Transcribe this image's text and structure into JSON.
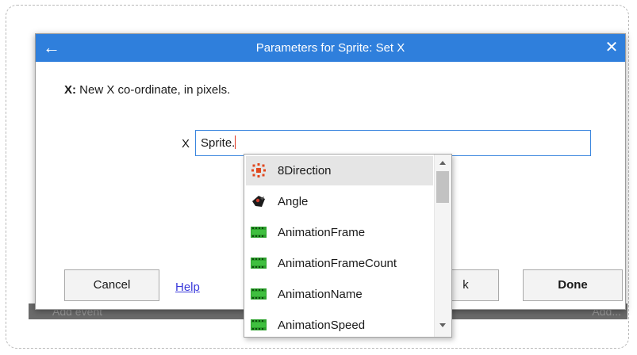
{
  "background_bar": {
    "add_event_label": "Add event",
    "add_right_label": "Add..."
  },
  "dialog": {
    "title": "Parameters for Sprite: Set X",
    "back_icon": "arrow-left-icon",
    "close_icon": "close-icon",
    "description_name": "X:",
    "description_text": " New X co-ordinate, in pixels.",
    "param_label": "X",
    "param_value": "Sprite.",
    "buttons": {
      "cancel": "Cancel",
      "help": "Help",
      "hidden_partial": "k",
      "done": "Done"
    }
  },
  "autocomplete": {
    "items": [
      {
        "label": "8Direction",
        "icon": "8direction-behavior-icon",
        "selected": true
      },
      {
        "label": "Angle",
        "icon": "sprite-angle-icon",
        "selected": false
      },
      {
        "label": "AnimationFrame",
        "icon": "film-icon",
        "selected": false
      },
      {
        "label": "AnimationFrameCount",
        "icon": "film-icon",
        "selected": false
      },
      {
        "label": "AnimationName",
        "icon": "film-icon",
        "selected": false
      },
      {
        "label": "AnimationSpeed",
        "icon": "film-icon",
        "selected": false
      }
    ]
  },
  "colors": {
    "titlebar": "#2f7fdc",
    "input_border": "#3b86de",
    "link": "#3a3adb",
    "film_icon": "#2da12d",
    "direction_icon": "#e0481e"
  }
}
